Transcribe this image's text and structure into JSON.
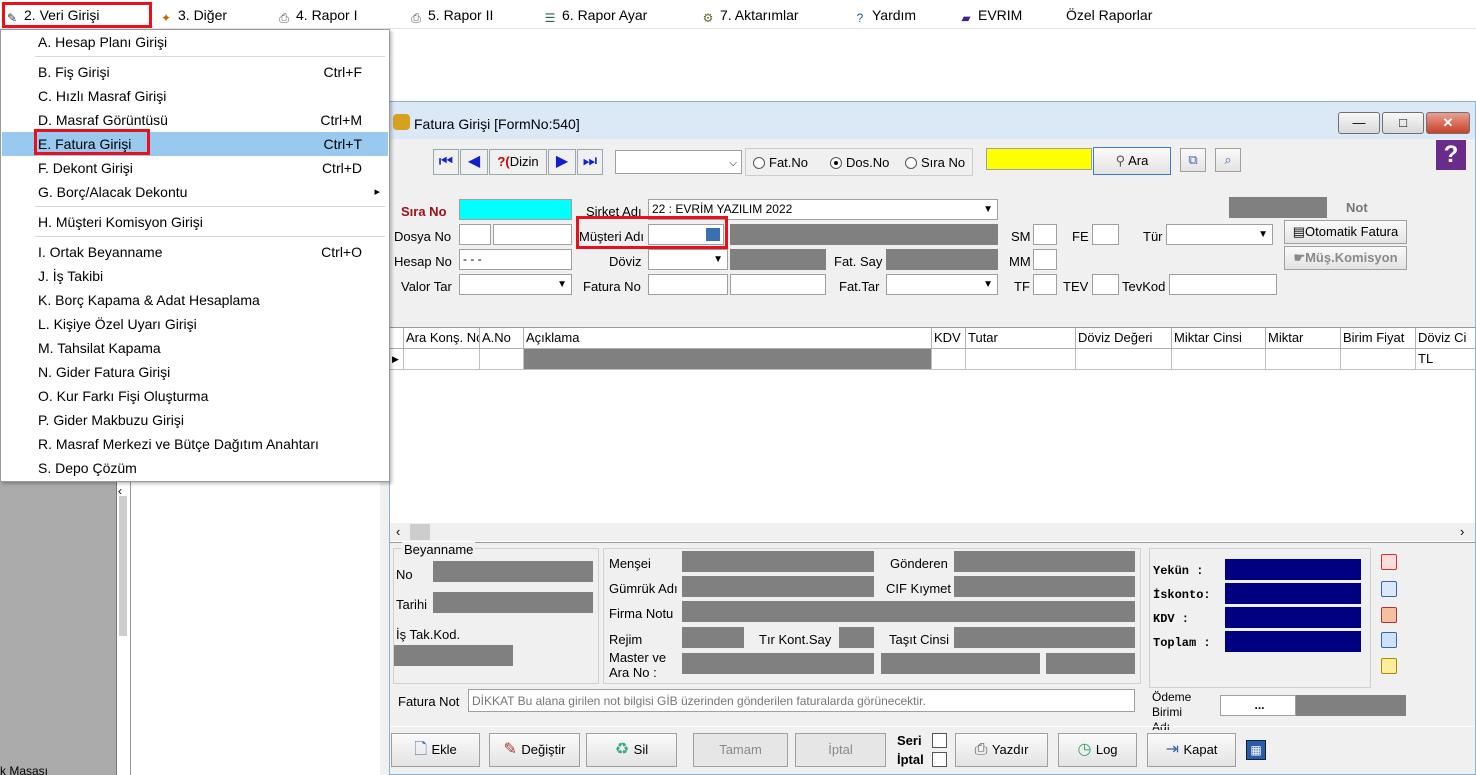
{
  "menubar": {
    "items": [
      {
        "label": "2.  Veri Girişi",
        "icon": "pencil-notebook-icon"
      },
      {
        "label": "3.  Diğer",
        "icon": "star-icon"
      },
      {
        "label": "4.  Rapor I",
        "icon": "printer-icon"
      },
      {
        "label": "5.  Rapor II",
        "icon": "printer-icon"
      },
      {
        "label": "6.  Rapor Ayar",
        "icon": "stack-icon"
      },
      {
        "label": "7.  Aktarımlar",
        "icon": "gears-icon"
      },
      {
        "label": "Yardım",
        "icon": "help-icon"
      },
      {
        "label": "EVRIM",
        "icon": "book-icon"
      },
      {
        "label": "Özel Raporlar",
        "icon": ""
      }
    ]
  },
  "dropdown": {
    "items": [
      {
        "label": "A.  Hesap Planı Girişi",
        "shortcut": ""
      },
      {
        "label": "B.  Fiş Girişi",
        "shortcut": "Ctrl+F"
      },
      {
        "label": "C.  Hızlı Masraf Girişi",
        "shortcut": ""
      },
      {
        "label": "D.  Masraf Görüntüsü",
        "shortcut": "Ctrl+M"
      },
      {
        "label": "E.   Fatura Girişi",
        "shortcut": "Ctrl+T"
      },
      {
        "label": "F.   Dekont Girişi",
        "shortcut": "Ctrl+D"
      },
      {
        "label": "G.  Borç/Alacak Dekontu",
        "shortcut": ""
      },
      {
        "label": "H.   Müşteri Komisyon Girişi",
        "shortcut": ""
      },
      {
        "label": "I.   Ortak Beyanname",
        "shortcut": "Ctrl+O"
      },
      {
        "label": "J.   İş Takibi",
        "shortcut": ""
      },
      {
        "label": "K.   Borç Kapama & Adat Hesaplama",
        "shortcut": ""
      },
      {
        "label": "L.   Kişiye Özel Uyarı Girişi",
        "shortcut": ""
      },
      {
        "label": "M.  Tahsilat Kapama",
        "shortcut": ""
      },
      {
        "label": "N. Gider Fatura Girişi",
        "shortcut": ""
      },
      {
        "label": "O. Kur Farkı Fişi Oluşturma",
        "shortcut": ""
      },
      {
        "label": "P. Gider Makbuzu Girişi",
        "shortcut": ""
      },
      {
        "label": "R. Masraf Merkezi ve Bütçe Dağıtım Anahtarı",
        "shortcut": ""
      },
      {
        "label": "S. Depo Çözüm",
        "shortcut": ""
      }
    ],
    "submenu_arrow": "▸"
  },
  "left": {
    "bottom_text": "k Masası"
  },
  "window": {
    "title": "Fatura Girişi [FormNo:540]",
    "min": "—",
    "max": "□",
    "close": "✕"
  },
  "toolbar": {
    "dizin": "Dizin",
    "dizin_prefix": "?(",
    "radio_fatno": "Fat.No",
    "radio_dosno": "Dos.No",
    "radio_sirano": "Sıra No",
    "search_button": "Ara",
    "help_glyph": "?"
  },
  "form": {
    "sira_no": "Sıra No",
    "sirket_adi": "Şirket Adı",
    "sirket_value": "22 : EVRİM YAZILIM  2022",
    "dosya_no": "Dosya No",
    "musteri_adi": "Müşteri Adı",
    "hesap_no": "Hesap No",
    "hesap_value": " -  -  -",
    "doviz": "Döviz",
    "fat_say": "Fat. Say",
    "valor_tar": "Valor Tar",
    "fatura_no": "Fatura No",
    "fat_tar": "Fat.Tar",
    "sm": "SM",
    "fe": "FE",
    "tur": "Tür",
    "mm": "MM",
    "tf": "TF",
    "tev": "TEV",
    "tevkod": "TevKod",
    "not": "Not",
    "otomatik_fatura": "Otomatik Fatura",
    "mus_komisyon": "Müş.Komisyon"
  },
  "grid": {
    "headers": [
      "Ara Konş. No",
      "A.No",
      "Açıklama",
      "KDV",
      "Tutar",
      "Döviz Değeri",
      "Miktar Cinsi",
      "Miktar",
      "Birim Fiyat",
      "Döviz Ci"
    ],
    "row_doviz": "TL",
    "row_marker": "▶"
  },
  "beyanname": {
    "legend": "Beyanname",
    "no": "No",
    "tarihi": "Tarihi",
    "is_tak_kod": "İş Tak.Kod."
  },
  "details": {
    "mensei": "Menşei",
    "gonderen": "Gönderen",
    "gumruk_adi": "Gümrük Adı",
    "cif_kiymet": "CIF Kıymet",
    "firma_notu": "Firma Notu",
    "rejim": "Rejim",
    "tir_kont_say": "Tır Kont.Say",
    "tasit_cinsi": "Taşıt Cinsi",
    "master_ara_no": "Master ve Ara No :"
  },
  "totals": {
    "yekun": "Yekün  :",
    "iskonto": "İskonto:",
    "kdv": "KDV     :",
    "toplam": "Toplam :"
  },
  "fatura_not": {
    "label": "Fatura Not",
    "placeholder": "DİKKAT Bu alana girilen not bilgisi GİB üzerinden gönderilen faturalarda görünecektir."
  },
  "odeme": {
    "label": "Ödeme Birimi Adı",
    "button": "..."
  },
  "bottom_buttons": {
    "ekle": "Ekle",
    "degistir": "Değiştir",
    "sil": "Sil",
    "tamam": "Tamam",
    "iptal": "İptal",
    "seri": "Seri",
    "iptal_chk": "İptal",
    "yazdir": "Yazdır",
    "log": "Log",
    "kapat": "Kapat"
  },
  "colors": {
    "highlight": "#e8101a",
    "selected": "#99c9ef",
    "navy": "#000080"
  }
}
